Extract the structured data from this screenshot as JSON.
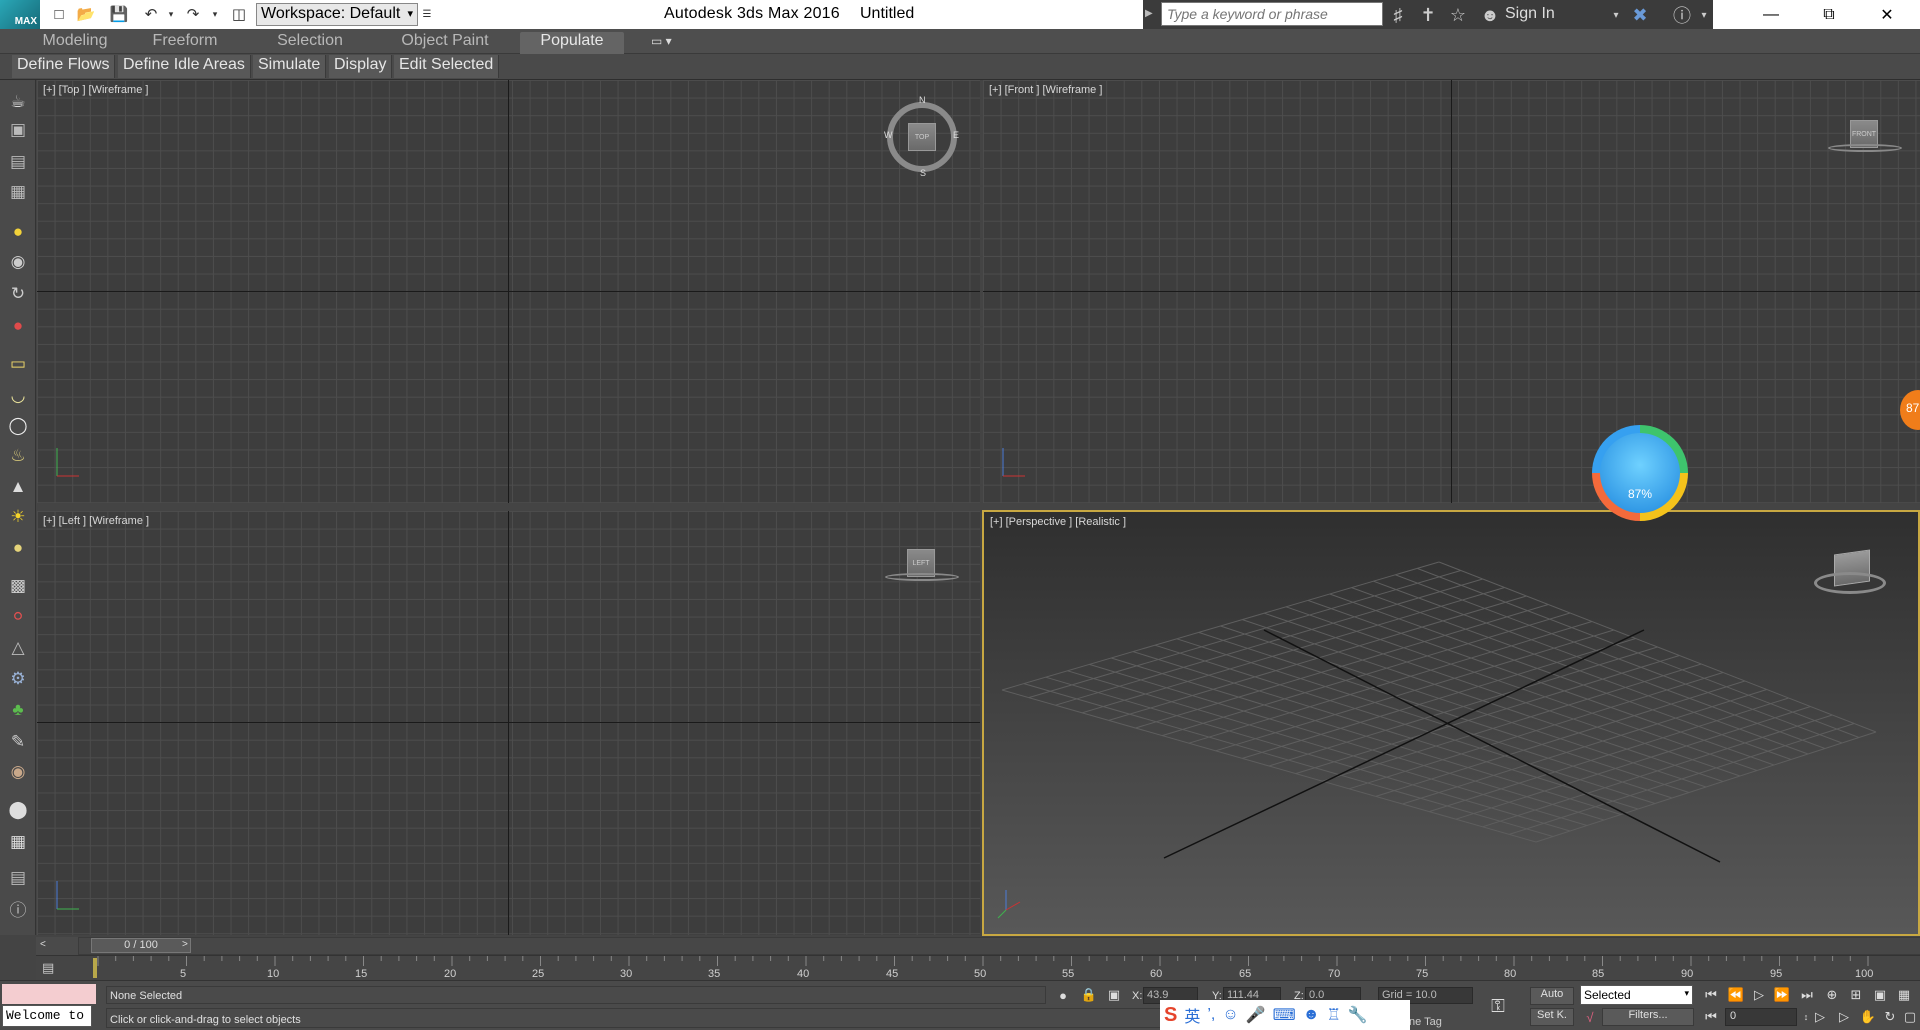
{
  "titlebar": {
    "logo": "MAX",
    "workspace_label": "Workspace: Default",
    "app_title": "Autodesk 3ds Max 2016",
    "doc_title": "Untitled",
    "search_placeholder": "Type a keyword or phrase",
    "signin_label": "Sign In",
    "minimize": "—",
    "restore": "⧉",
    "close": "✕"
  },
  "ribbon": {
    "tabs": [
      {
        "label": "Modeling"
      },
      {
        "label": "Freeform"
      },
      {
        "label": "Selection"
      },
      {
        "label": "Object Paint"
      },
      {
        "label": "Populate"
      }
    ],
    "active_tab": "Populate",
    "buttons": [
      {
        "label": "Define Flows"
      },
      {
        "label": "Define Idle Areas"
      },
      {
        "label": "Simulate"
      },
      {
        "label": "Display"
      },
      {
        "label": "Edit Selected"
      }
    ]
  },
  "viewports": {
    "top": {
      "label": "[+] [Top ] [Wireframe ]",
      "cube": "TOP",
      "compass": {
        "n": "N",
        "s": "S",
        "e": "E",
        "w": "W"
      }
    },
    "front": {
      "label": "[+] [Front ] [Wireframe ]",
      "cube": "FRONT"
    },
    "left": {
      "label": "[+] [Left ] [Wireframe ]",
      "cube": "LEFT"
    },
    "perspective": {
      "label": "[+] [Perspective ] [Realistic ]"
    }
  },
  "timeline": {
    "position_label": "0 / 100",
    "prev": "<",
    "next": ">",
    "ticks": [
      "5",
      "10",
      "15",
      "20",
      "25",
      "30",
      "35",
      "40",
      "45",
      "50",
      "55",
      "60",
      "65",
      "70",
      "75",
      "80",
      "85",
      "90",
      "95",
      "100"
    ]
  },
  "status": {
    "selection": "None Selected",
    "prompt": "Click or click-and-drag to select objects",
    "welcome": "Welcome to",
    "x_label": "X:",
    "x_value": "43.9",
    "y_label": "Y:",
    "y_value": "111.44",
    "z_label": "Z:",
    "z_value": "0.0",
    "grid": "Grid = 10.0",
    "auto_label": "Auto",
    "setk_label": "Set K.",
    "selected_value": "Selected",
    "filters_label": "Filters...",
    "frame_value": "0",
    "time_tag": "ne Tag"
  },
  "overlays": {
    "assistant_percent": "87%",
    "side_badge": "87",
    "ime_label": "英"
  }
}
